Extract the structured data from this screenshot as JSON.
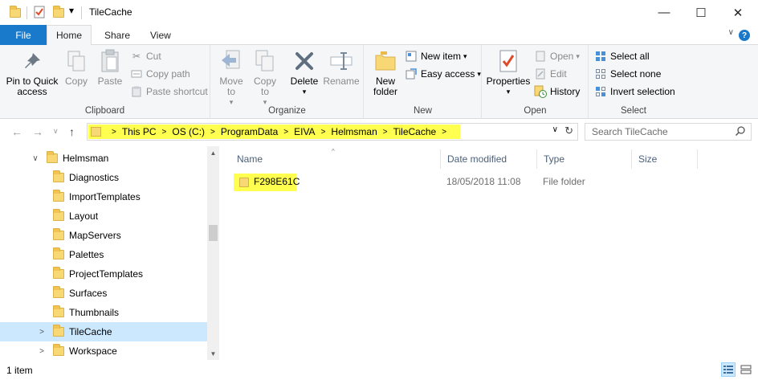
{
  "window": {
    "title": "TileCache",
    "minimize": "—",
    "maximize": "☐",
    "close": "✕",
    "qa_dropdown": "▾"
  },
  "ribbon_tabs": [
    "File",
    "Home",
    "Share",
    "View"
  ],
  "ribbon": {
    "clipboard": {
      "label": "Clipboard",
      "pin_to_quick_access": "Pin to Quick access",
      "copy": "Copy",
      "paste": "Paste",
      "cut": "Cut",
      "copy_path": "Copy path",
      "paste_shortcut": "Paste shortcut"
    },
    "organize": {
      "label": "Organize",
      "move_to": "Move to",
      "copy_to": "Copy to",
      "delete": "Delete",
      "rename": "Rename"
    },
    "new": {
      "label": "New",
      "new_folder": "New folder",
      "new_item": "New item",
      "easy_access": "Easy access"
    },
    "open": {
      "label": "Open",
      "properties": "Properties",
      "open": "Open",
      "edit": "Edit",
      "history": "History"
    },
    "select": {
      "label": "Select",
      "select_all": "Select all",
      "select_none": "Select none",
      "invert_selection": "Invert selection"
    }
  },
  "address": {
    "crumbs": [
      "This PC",
      "OS (C:)",
      "ProgramData",
      "EIVA",
      "Helmsman",
      "TileCache"
    ]
  },
  "search": {
    "placeholder": "Search TileCache"
  },
  "nav_tree": [
    {
      "label": "Helmsman",
      "expanded": true
    },
    {
      "label": "Diagnostics"
    },
    {
      "label": "ImportTemplates"
    },
    {
      "label": "Layout"
    },
    {
      "label": "MapServers"
    },
    {
      "label": "Palettes"
    },
    {
      "label": "ProjectTemplates"
    },
    {
      "label": "Surfaces"
    },
    {
      "label": "Thumbnails"
    },
    {
      "label": "TileCache",
      "selected": true
    },
    {
      "label": "Workspace"
    }
  ],
  "columns": [
    "Name",
    "Date modified",
    "Type",
    "Size"
  ],
  "files": [
    {
      "name": "F298E61C",
      "date_modified": "18/05/2018 11:08",
      "type": "File folder",
      "size": ""
    }
  ],
  "status": {
    "item_count": "1 item"
  },
  "colors": {
    "accent": "#1979ca",
    "highlight": "#ffff50",
    "selection": "#cce8ff",
    "folder": "#f8d775"
  }
}
